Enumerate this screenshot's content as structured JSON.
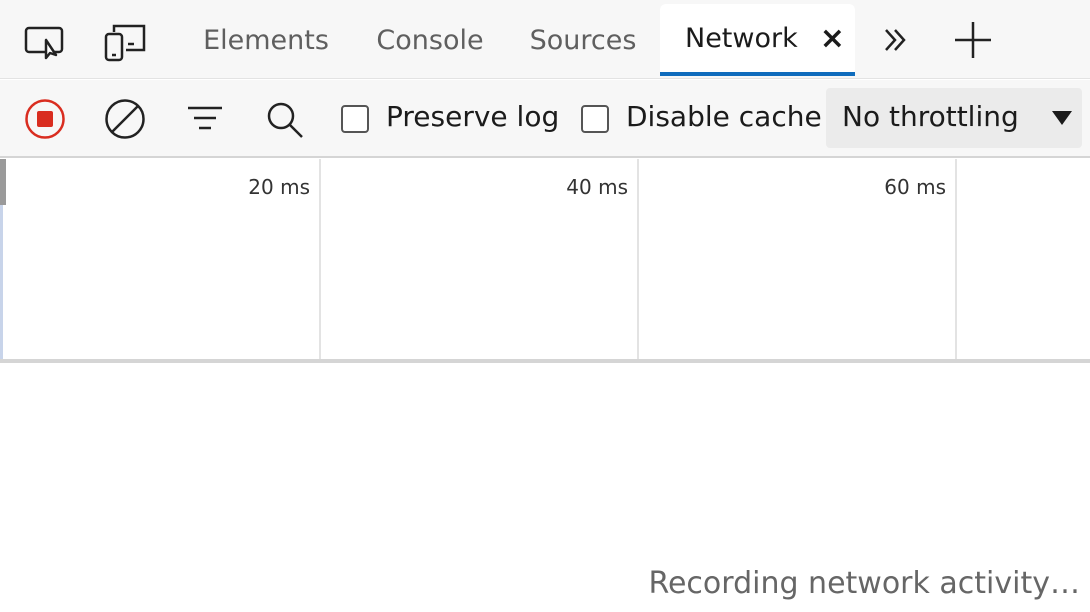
{
  "tabs": [
    {
      "label": "Elements"
    },
    {
      "label": "Console"
    },
    {
      "label": "Sources"
    },
    {
      "label": "Network",
      "active": true
    }
  ],
  "tab_close_label": "×",
  "more_tabs_label": "»",
  "toolbar": {
    "preserve_log": "Preserve log",
    "preserve_log_checked": false,
    "disable_cache": "Disable cache",
    "disable_cache_checked": false,
    "throttling": "No throttling"
  },
  "overview": {
    "ticks": [
      "20 ms",
      "40 ms",
      "60 ms"
    ]
  },
  "status": "Recording network activity…",
  "colors": {
    "record": "#d92d20",
    "accent": "#0f6cbd"
  }
}
